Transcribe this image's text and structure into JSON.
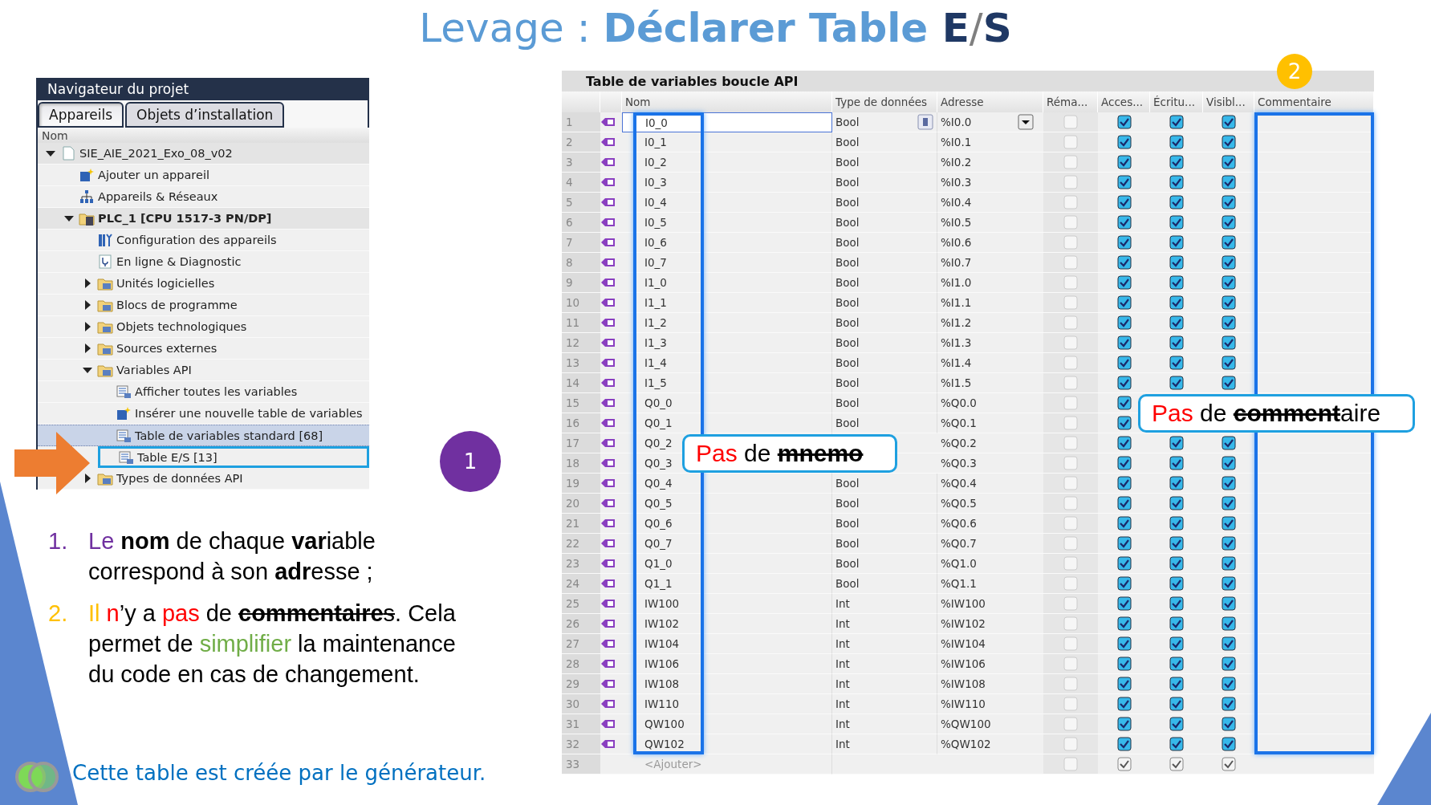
{
  "title": [
    {
      "text": "Levage : ",
      "kind": "light"
    },
    {
      "text": "Déclarer Table ",
      "kind": "bold"
    },
    {
      "text": "E",
      "kind": "letter"
    },
    {
      "text": "/",
      "kind": "separator"
    },
    {
      "text": "S",
      "kind": "letter"
    }
  ],
  "navigator": {
    "title": "Navigateur du projet",
    "tabs": [
      {
        "label": "Appareils",
        "selected": true
      },
      {
        "label": "Objets d’installation",
        "selected": false
      }
    ],
    "column": "Nom",
    "tree": [
      {
        "label": "SIE_AIE_2021_Exo_08_v02",
        "kind": "document",
        "expanded": true,
        "selected": false,
        "highlighted": false,
        "children": [
          {
            "label": "Ajouter un appareil",
            "kind": "add",
            "selected": false,
            "highlighted": false
          },
          {
            "label": "Appareils & Réseaux",
            "kind": "network",
            "selected": false,
            "highlighted": false
          },
          {
            "label": "PLC_1 [CPU 1517-3 PN/DP]",
            "kind": "plc",
            "expanded": true,
            "selected": false,
            "highlighted": false,
            "children": [
              {
                "label": "Configuration des appareils",
                "kind": "config",
                "selected": false,
                "highlighted": false
              },
              {
                "label": "En ligne & Diagnostic",
                "kind": "diag",
                "selected": false,
                "highlighted": false
              },
              {
                "label": "Unités logicielles",
                "kind": "folder",
                "expanded": false,
                "selected": false,
                "highlighted": false
              },
              {
                "label": "Blocs de programme",
                "kind": "folder",
                "expanded": false,
                "selected": false,
                "highlighted": false
              },
              {
                "label": "Objets technologiques",
                "kind": "folder",
                "expanded": false,
                "selected": false,
                "highlighted": false
              },
              {
                "label": "Sources externes",
                "kind": "folder",
                "expanded": false,
                "selected": false,
                "highlighted": false
              },
              {
                "label": "Variables API",
                "kind": "folder",
                "expanded": true,
                "selected": false,
                "highlighted": false,
                "children": [
                  {
                    "label": "Afficher toutes les variables",
                    "kind": "table",
                    "selected": false,
                    "highlighted": false
                  },
                  {
                    "label": "Insérer une nouvelle table de variables",
                    "kind": "add",
                    "selected": false,
                    "highlighted": false
                  },
                  {
                    "label": "Table de variables standard [68]",
                    "kind": "table",
                    "selected": true,
                    "highlighted": false
                  },
                  {
                    "label": "Table E/S [13]",
                    "kind": "table",
                    "selected": false,
                    "highlighted": true
                  }
                ]
              },
              {
                "label": "Types de données API",
                "kind": "folder",
                "expanded": false,
                "selected": false,
                "highlighted": false
              }
            ]
          }
        ]
      }
    ]
  },
  "badge_1": "1",
  "points": [
    {
      "number": "1.",
      "color": "#7030a0",
      "segments": [
        {
          "text": "Le ",
          "color": "#7030a0"
        },
        {
          "text": "nom",
          "kind": "bold"
        },
        {
          "text": " de chaque "
        },
        {
          "text": "var",
          "kind": "bold"
        },
        {
          "text": "iable correspond à son "
        },
        {
          "text": "adr",
          "kind": "bold"
        },
        {
          "text": "esse ;"
        }
      ]
    },
    {
      "number": "2.",
      "color": "#ffc000",
      "segments": [
        {
          "text": "Il ",
          "color": "#ffc000"
        },
        {
          "text": "n",
          "color": "#ff0000"
        },
        {
          "text": "’y a "
        },
        {
          "text": "pas",
          "color": "#ff0000"
        },
        {
          "text": " de "
        },
        {
          "text": "commentaire",
          "kind": "bold-strike"
        },
        {
          "text": "s",
          "kind": "strike"
        },
        {
          "text": ". Cela permet de "
        },
        {
          "text": "simplifier",
          "color": "#70ad47"
        },
        {
          "text": " la maintenance du code en cas de changement."
        }
      ]
    }
  ],
  "footer": "Cette table est créée par le générateur.",
  "table": {
    "title": "Table de variables boucle API",
    "columns": [
      "Nom",
      "Type de données",
      "Adresse",
      "Réma...",
      "Acces...",
      "Écritu...",
      "Visibl...",
      "Commentaire"
    ],
    "rows": [
      {
        "kind": "var",
        "number": "1",
        "name": "I0_0",
        "type": "Bool",
        "address": "%I0.0",
        "editing": true,
        "remanent": false,
        "access": true,
        "write": true,
        "visible": true
      },
      {
        "kind": "var",
        "number": "2",
        "name": "I0_1",
        "type": "Bool",
        "address": "%I0.1",
        "editing": false,
        "remanent": false,
        "access": true,
        "write": true,
        "visible": true
      },
      {
        "kind": "var",
        "number": "3",
        "name": "I0_2",
        "type": "Bool",
        "address": "%I0.2",
        "editing": false,
        "remanent": false,
        "access": true,
        "write": true,
        "visible": true
      },
      {
        "kind": "var",
        "number": "4",
        "name": "I0_3",
        "type": "Bool",
        "address": "%I0.3",
        "editing": false,
        "remanent": false,
        "access": true,
        "write": true,
        "visible": true
      },
      {
        "kind": "var",
        "number": "5",
        "name": "I0_4",
        "type": "Bool",
        "address": "%I0.4",
        "editing": false,
        "remanent": false,
        "access": true,
        "write": true,
        "visible": true
      },
      {
        "kind": "var",
        "number": "6",
        "name": "I0_5",
        "type": "Bool",
        "address": "%I0.5",
        "editing": false,
        "remanent": false,
        "access": true,
        "write": true,
        "visible": true
      },
      {
        "kind": "var",
        "number": "7",
        "name": "I0_6",
        "type": "Bool",
        "address": "%I0.6",
        "editing": false,
        "remanent": false,
        "access": true,
        "write": true,
        "visible": true
      },
      {
        "kind": "var",
        "number": "8",
        "name": "I0_7",
        "type": "Bool",
        "address": "%I0.7",
        "editing": false,
        "remanent": false,
        "access": true,
        "write": true,
        "visible": true
      },
      {
        "kind": "var",
        "number": "9",
        "name": "I1_0",
        "type": "Bool",
        "address": "%I1.0",
        "editing": false,
        "remanent": false,
        "access": true,
        "write": true,
        "visible": true
      },
      {
        "kind": "var",
        "number": "10",
        "name": "I1_1",
        "type": "Bool",
        "address": "%I1.1",
        "editing": false,
        "remanent": false,
        "access": true,
        "write": true,
        "visible": true
      },
      {
        "kind": "var",
        "number": "11",
        "name": "I1_2",
        "type": "Bool",
        "address": "%I1.2",
        "editing": false,
        "remanent": false,
        "access": true,
        "write": true,
        "visible": true
      },
      {
        "kind": "var",
        "number": "12",
        "name": "I1_3",
        "type": "Bool",
        "address": "%I1.3",
        "editing": false,
        "remanent": false,
        "access": true,
        "write": true,
        "visible": true
      },
      {
        "kind": "var",
        "number": "13",
        "name": "I1_4",
        "type": "Bool",
        "address": "%I1.4",
        "editing": false,
        "remanent": false,
        "access": true,
        "write": true,
        "visible": true
      },
      {
        "kind": "var",
        "number": "14",
        "name": "I1_5",
        "type": "Bool",
        "address": "%I1.5",
        "editing": false,
        "remanent": false,
        "access": true,
        "write": true,
        "visible": true
      },
      {
        "kind": "var",
        "number": "15",
        "name": "Q0_0",
        "type": "Bool",
        "address": "%Q0.0",
        "editing": false,
        "remanent": false,
        "access": true
      },
      {
        "kind": "var",
        "number": "16",
        "name": "Q0_1",
        "type": "Bool",
        "address": "%Q0.1",
        "editing": false,
        "remanent": false,
        "access": true
      },
      {
        "kind": "var",
        "number": "17",
        "name": "Q0_2",
        "address": "%Q0.2",
        "editing": false,
        "remanent": false,
        "access": true,
        "write": true,
        "visible": true
      },
      {
        "kind": "var",
        "number": "18",
        "name": "Q0_3",
        "address": "%Q0.3",
        "editing": false,
        "remanent": false,
        "access": true,
        "write": true,
        "visible": true
      },
      {
        "kind": "var",
        "number": "19",
        "name": "Q0_4",
        "type": "Bool",
        "address": "%Q0.4",
        "editing": false,
        "remanent": false,
        "access": true,
        "write": true,
        "visible": true
      },
      {
        "kind": "var",
        "number": "20",
        "name": "Q0_5",
        "type": "Bool",
        "address": "%Q0.5",
        "editing": false,
        "remanent": false,
        "access": true,
        "write": true,
        "visible": true
      },
      {
        "kind": "var",
        "number": "21",
        "name": "Q0_6",
        "type": "Bool",
        "address": "%Q0.6",
        "editing": false,
        "remanent": false,
        "access": true,
        "write": true,
        "visible": true
      },
      {
        "kind": "var",
        "number": "22",
        "name": "Q0_7",
        "type": "Bool",
        "address": "%Q0.7",
        "editing": false,
        "remanent": false,
        "access": true,
        "write": true,
        "visible": true
      },
      {
        "kind": "var",
        "number": "23",
        "name": "Q1_0",
        "type": "Bool",
        "address": "%Q1.0",
        "editing": false,
        "remanent": false,
        "access": true,
        "write": true,
        "visible": true
      },
      {
        "kind": "var",
        "number": "24",
        "name": "Q1_1",
        "type": "Bool",
        "address": "%Q1.1",
        "editing": false,
        "remanent": false,
        "access": true,
        "write": true,
        "visible": true
      },
      {
        "kind": "var",
        "number": "25",
        "name": "IW100",
        "type": "Int",
        "address": "%IW100",
        "editing": false,
        "remanent": false,
        "access": true,
        "write": true,
        "visible": true
      },
      {
        "kind": "var",
        "number": "26",
        "name": "IW102",
        "type": "Int",
        "address": "%IW102",
        "editing": false,
        "remanent": false,
        "access": true,
        "write": true,
        "visible": true
      },
      {
        "kind": "var",
        "number": "27",
        "name": "IW104",
        "type": "Int",
        "address": "%IW104",
        "editing": false,
        "remanent": false,
        "access": true,
        "write": true,
        "visible": true
      },
      {
        "kind": "var",
        "number": "28",
        "name": "IW106",
        "type": "Int",
        "address": "%IW106",
        "editing": false,
        "remanent": false,
        "access": true,
        "write": true,
        "visible": true
      },
      {
        "kind": "var",
        "number": "29",
        "name": "IW108",
        "type": "Int",
        "address": "%IW108",
        "editing": false,
        "remanent": false,
        "access": true,
        "write": true,
        "visible": true
      },
      {
        "kind": "var",
        "number": "30",
        "name": "IW110",
        "type": "Int",
        "address": "%IW110",
        "editing": false,
        "remanent": false,
        "access": true,
        "write": true,
        "visible": true
      },
      {
        "kind": "var",
        "number": "31",
        "name": "QW100",
        "type": "Int",
        "address": "%QW100",
        "editing": false,
        "remanent": false,
        "access": true,
        "write": true,
        "visible": true
      },
      {
        "kind": "var",
        "number": "32",
        "name": "QW102",
        "type": "Int",
        "address": "%QW102",
        "editing": false,
        "remanent": false,
        "access": true,
        "write": true,
        "visible": true
      },
      {
        "kind": "add",
        "number": "33",
        "placeholder": "<Ajouter>",
        "remanent": false,
        "access": true,
        "write": true,
        "visible": true
      }
    ]
  },
  "badge_2": "2",
  "callouts": [
    {
      "kind": "name",
      "segments": [
        {
          "text": "Pas",
          "color": "#ff0000"
        },
        {
          "text": " de "
        },
        {
          "text": "mnemo",
          "kind": "bold-strike"
        }
      ]
    },
    {
      "kind": "comment",
      "segments": [
        {
          "text": "Pas",
          "color": "#ff0000"
        },
        {
          "text": " de "
        },
        {
          "text": "comment",
          "kind": "bold-strike"
        },
        {
          "text": "aire"
        }
      ]
    }
  ]
}
